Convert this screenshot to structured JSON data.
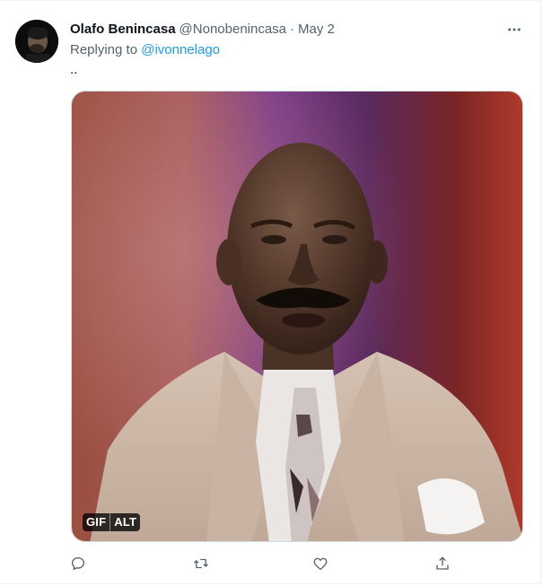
{
  "tweet": {
    "author_name": "Olafo Benincasa",
    "author_handle": "@Nonobenincasa",
    "separator": "·",
    "date": "May 2",
    "replying_to_prefix": "Replying to ",
    "replying_to_handle": "@ivonnelago",
    "text": ".."
  },
  "media": {
    "gif_badge": "GIF",
    "alt_badge": "ALT"
  },
  "actions": {
    "reply_icon": "reply-icon",
    "retweet_icon": "retweet-icon",
    "like_icon": "heart-icon",
    "share_icon": "share-icon"
  },
  "colors": {
    "link": "#1d9bf0",
    "muted": "#536471",
    "text": "#0f1419",
    "border": "#cfd9de"
  }
}
